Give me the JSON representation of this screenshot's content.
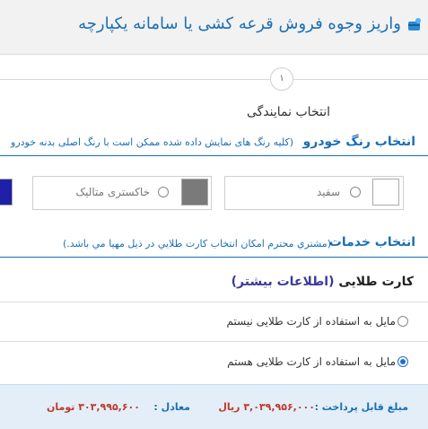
{
  "header": {
    "title": "واریز وجوه فروش قرعه کشی یا سامانه یکپارچه",
    "icon": "payment-icon"
  },
  "stepper": {
    "step_number": "۱",
    "step_label": "انتخاب نمایندگی"
  },
  "color_section": {
    "title": "انتخاب رنگ خودرو",
    "hint": "(کلیه رنگ های نمایش داده شده ممکن است با رنگ اصلی بدنه خودرو",
    "options": [
      {
        "label": "سفید",
        "color": "#ffffff",
        "selected": false
      },
      {
        "label": "خاکستری متالیک",
        "color": "#7a7a7a",
        "selected": false
      },
      {
        "label": "",
        "color": "#1f1fa8",
        "selected": false
      }
    ]
  },
  "services_section": {
    "title": "انتخاب خدمات",
    "hint": "(مشتري محترم امکان انتخاب کارت طلايي در ذيل مهيا مي باشد.)"
  },
  "gold_card": {
    "title": "کارت طلایی",
    "link": "(اطلاعات بیشتر)",
    "options": [
      {
        "label": "مایل به استفاده از کارت طلایی نیستم",
        "selected": false
      },
      {
        "label": "مایل به استفاده از کارت طلایی هستم",
        "selected": true
      }
    ]
  },
  "footer": {
    "payable_label": "مبلغ قابل پرداخت :",
    "payable_value": "۳,۰۳۹,۹۵۶,۰۰۰ ریال",
    "equal_label": "معادل :",
    "equal_value": "۳۰۳,۹۹۵,۶۰۰ تومان"
  },
  "colors": {
    "accent": "#1a6fb3",
    "radio_selected": "#1f6fd1",
    "price": "#c0392b",
    "footer_bg": "#e3eef8"
  }
}
